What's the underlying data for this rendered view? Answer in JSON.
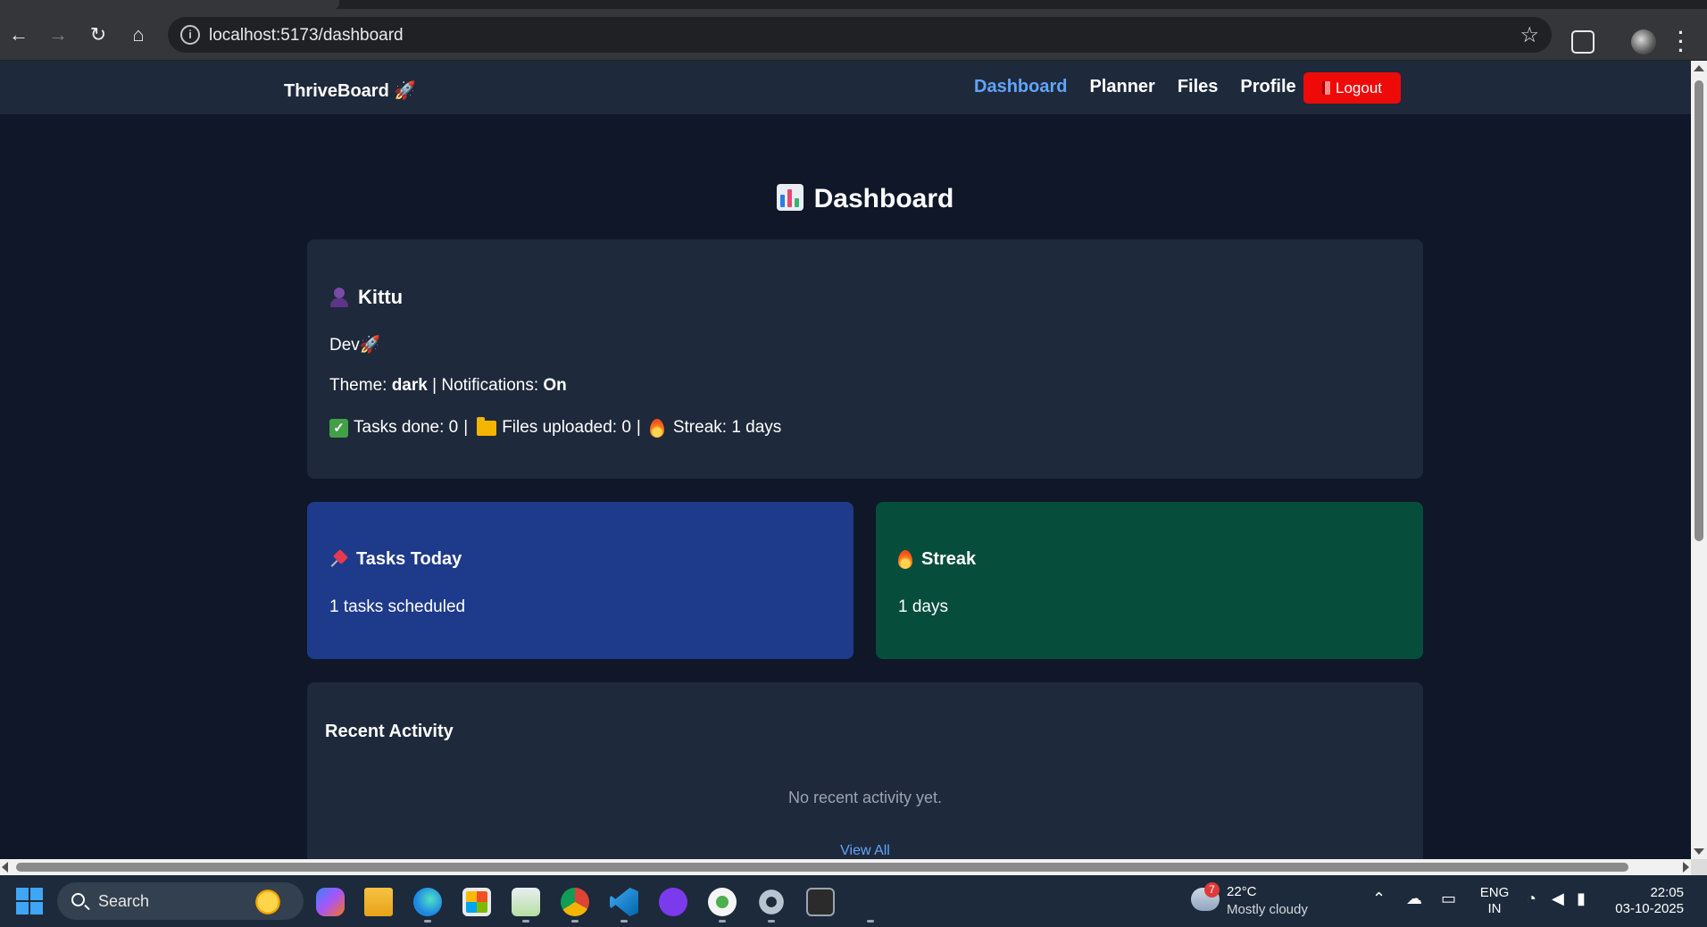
{
  "browser": {
    "url": "localhost:5173/dashboard"
  },
  "app": {
    "brand": "ThriveBoard 🚀",
    "nav": [
      "Dashboard",
      "Planner",
      "Files",
      "Profile"
    ],
    "logout_label": "Logout"
  },
  "page": {
    "title": "Dashboard"
  },
  "profile": {
    "name": "Kittu",
    "bio": "Dev🚀",
    "theme_label": "Theme:",
    "theme_value": "dark",
    "separator": "|",
    "notifications_label": "Notifications:",
    "notifications_value": "On",
    "tasks_done": "Tasks done: 0",
    "files_uploaded": "Files uploaded: 0",
    "streak": "Streak: 1 days"
  },
  "tasks_card": {
    "title": "Tasks Today",
    "value": "1 tasks scheduled",
    "color": "#1e3a8a"
  },
  "streak_card": {
    "title": "Streak",
    "value": "1 days",
    "color": "#064e3b"
  },
  "activity": {
    "title": "Recent Activity",
    "empty": "No recent activity yet.",
    "view_all": "View All"
  },
  "taskbar": {
    "search_label": "Search",
    "weather_badge": "7",
    "weather_temp": "22°C",
    "weather_condition": "Mostly cloudy",
    "lang": "ENG",
    "region": "IN",
    "time": "22:05",
    "date": "03-10-2025"
  },
  "colors": {
    "accent": "#60a5fa",
    "logout": "#ef0a0a",
    "page_bg": "#0f1729",
    "card_bg": "#1e293b"
  }
}
